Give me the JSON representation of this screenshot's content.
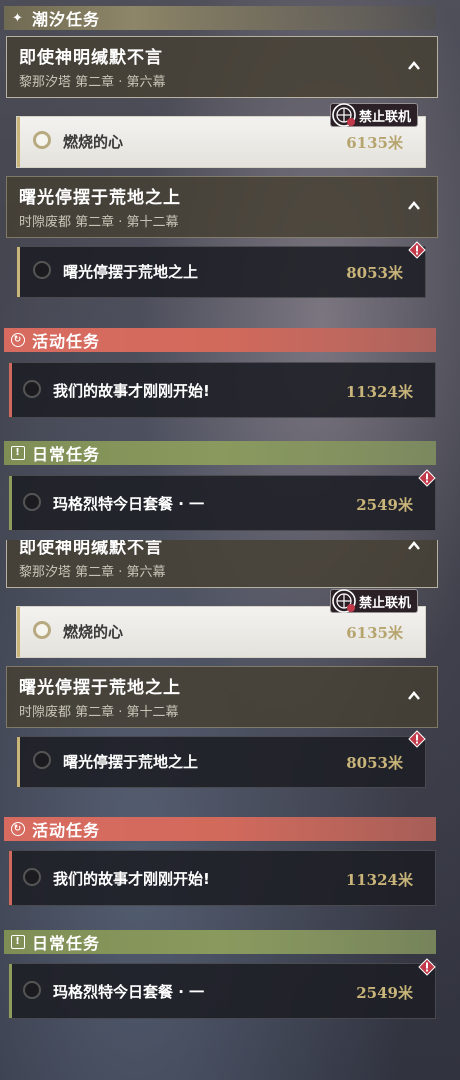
{
  "colors": {
    "gold": "#c9b57a",
    "event": "#d86b60",
    "daily": "#8a9a5e",
    "alert": "#c23a4a"
  },
  "sections": {
    "tide": {
      "label": "潮汐任务",
      "icon": "sparkle-icon"
    },
    "event": {
      "label": "活动任务",
      "icon": "refresh-icon"
    },
    "daily": {
      "label": "日常任务",
      "icon": "exclamation-box-icon"
    }
  },
  "chapters": {
    "c1": {
      "title": "即使神明缄默不言",
      "subtitle": "黎那汐塔 第二章 · 第六幕",
      "icon": "chevron-up-icon"
    },
    "c2": {
      "title": "曙光停摆于荒地之上",
      "subtitle": "时隙废都 第二章 · 第十二幕",
      "icon": "chevron-up-icon"
    }
  },
  "tasks": {
    "t1": {
      "name": "燃烧的心",
      "distance": "6135米",
      "badge": "禁止联机",
      "state": "active"
    },
    "t2": {
      "name": "曙光停摆于荒地之上",
      "distance": "8053米",
      "alert_icon": "alert-diamond-icon"
    },
    "t3": {
      "name": "我们的故事才刚刚开始!",
      "distance": "11324米"
    },
    "t4": {
      "name": "玛格烈特今日套餐 · 一",
      "distance": "2549米",
      "alert_icon": "alert-diamond-icon"
    }
  }
}
